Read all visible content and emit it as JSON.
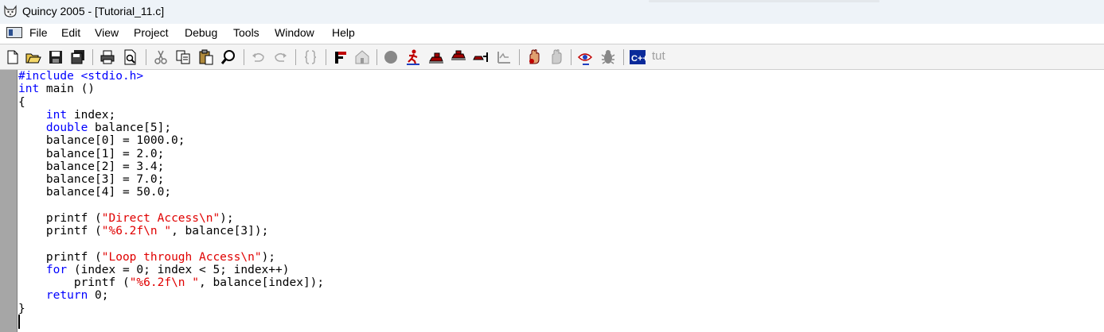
{
  "window": {
    "title": "Quincy 2005 - [Tutorial_11.c]"
  },
  "menubar": {
    "items": [
      {
        "label": "File"
      },
      {
        "label": "Edit"
      },
      {
        "label": "View"
      },
      {
        "label": "Project"
      },
      {
        "label": "Debug"
      },
      {
        "label": "Tools"
      },
      {
        "label": "Window"
      },
      {
        "label": "Help"
      }
    ]
  },
  "toolbar": {
    "tut_label": "tut",
    "icons": [
      "new-file-icon",
      "open-folder-icon",
      "save-icon",
      "save-all-icon",
      "print-icon",
      "print-preview-icon",
      "cut-icon",
      "copy-icon",
      "paste-icon",
      "find-icon",
      "undo-icon",
      "redo-icon",
      "braces-icon",
      "compile-icon",
      "build-icon",
      "stop-icon",
      "run-icon",
      "step-icon",
      "step-over-icon",
      "step-out-icon",
      "run-to-cursor-icon",
      "breakpoint-hand-icon",
      "clear-breakpoint-icon",
      "watch-icon",
      "bug-icon",
      "cpp-icon"
    ]
  },
  "editor": {
    "keyword_color": "#0000ff",
    "string_color": "#e00000",
    "lines": [
      [
        {
          "t": "#include <stdio.h>",
          "c": "kw"
        }
      ],
      [
        {
          "t": "int",
          "c": "kw"
        },
        {
          "t": " main ()"
        }
      ],
      [
        {
          "t": "{"
        }
      ],
      [
        {
          "t": "    "
        },
        {
          "t": "int",
          "c": "kw"
        },
        {
          "t": " index;"
        }
      ],
      [
        {
          "t": "    "
        },
        {
          "t": "double",
          "c": "kw"
        },
        {
          "t": " balance[5];"
        }
      ],
      [
        {
          "t": "    balance[0] = 1000.0;"
        }
      ],
      [
        {
          "t": "    balance[1] = 2.0;"
        }
      ],
      [
        {
          "t": "    balance[2] = 3.4;"
        }
      ],
      [
        {
          "t": "    balance[3] = 7.0;"
        }
      ],
      [
        {
          "t": "    balance[4] = 50.0;"
        }
      ],
      [
        {
          "t": ""
        }
      ],
      [
        {
          "t": "    printf ("
        },
        {
          "t": "\"Direct Access\\n\"",
          "c": "str"
        },
        {
          "t": ");"
        }
      ],
      [
        {
          "t": "    printf ("
        },
        {
          "t": "\"%6.2f\\n \"",
          "c": "str"
        },
        {
          "t": ", balance[3]);"
        }
      ],
      [
        {
          "t": ""
        }
      ],
      [
        {
          "t": "    printf ("
        },
        {
          "t": "\"Loop through Access\\n\"",
          "c": "str"
        },
        {
          "t": ");"
        }
      ],
      [
        {
          "t": "    "
        },
        {
          "t": "for",
          "c": "kw"
        },
        {
          "t": " (index = 0; index < 5; index++)"
        }
      ],
      [
        {
          "t": "        printf ("
        },
        {
          "t": "\"%6.2f\\n \"",
          "c": "str"
        },
        {
          "t": ", balance[index]);"
        }
      ],
      [
        {
          "t": "    "
        },
        {
          "t": "return",
          "c": "kw"
        },
        {
          "t": " 0;"
        }
      ],
      [
        {
          "t": "}"
        }
      ]
    ]
  }
}
